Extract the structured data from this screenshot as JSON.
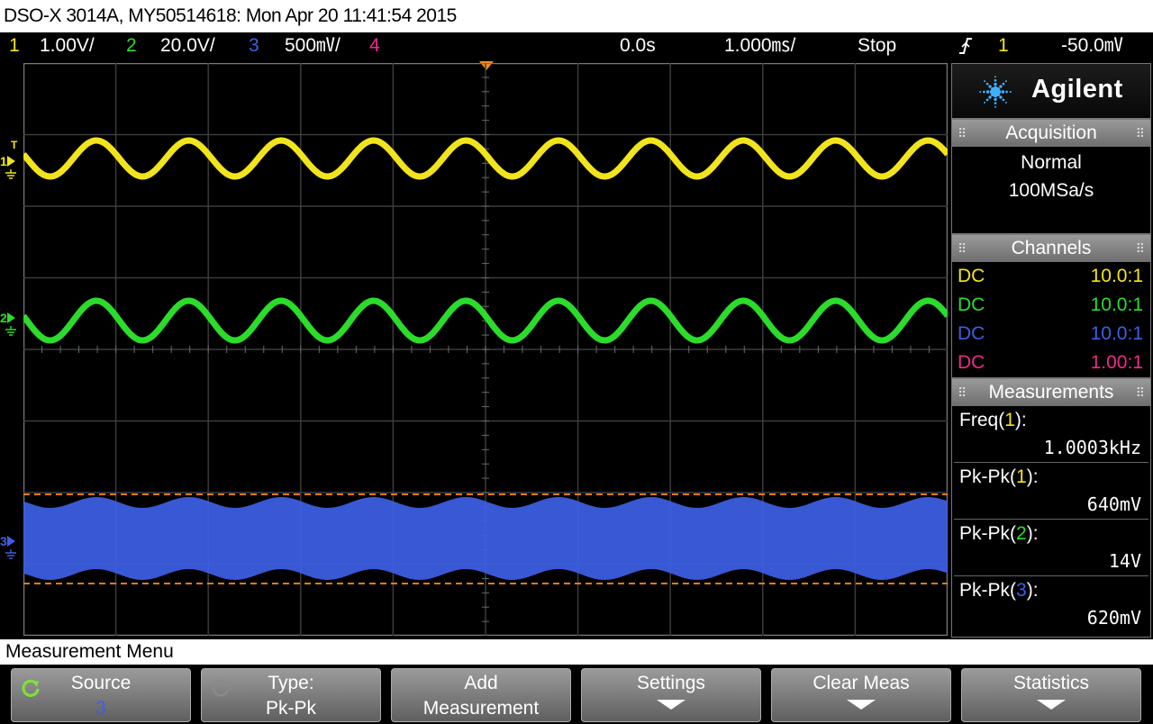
{
  "title": "DSO-X 3014A, MY50514618: Mon Apr 20 11:41:54 2015",
  "colors": {
    "ch1": "#f2e41c",
    "ch2": "#2bdc2b",
    "ch3": "#3d5fe6",
    "ch4": "#ee2a8a",
    "trigger": "#ff8c1a"
  },
  "status": {
    "ch1_num": "1",
    "ch1_scale": "1.00V/",
    "ch2_num": "2",
    "ch2_scale": "20.0V/",
    "ch3_num": "3",
    "ch3_scale": "500㎷/",
    "ch4_num": "4",
    "time_delay": "0.0s",
    "time_scale": "1.000㎳/",
    "run_state": "Stop",
    "trigger_slope_icon": "rising-edge-icon",
    "trigger_source": "1",
    "trigger_level": "-50.0㎷"
  },
  "channel_markers": {
    "ch1": "1",
    "ch2": "2",
    "ch3": "3",
    "trigger_level_marker": "T"
  },
  "panel": {
    "brand": "Agilent",
    "acquisition": {
      "header": "Acquisition",
      "mode": "Normal",
      "rate": "100MSa/s"
    },
    "channels": {
      "header": "Channels",
      "rows": [
        {
          "coupling": "DC",
          "ratio": "10.0:1"
        },
        {
          "coupling": "DC",
          "ratio": "10.0:1"
        },
        {
          "coupling": "DC",
          "ratio": "10.0:1"
        },
        {
          "coupling": "DC",
          "ratio": "1.00:1"
        }
      ]
    },
    "measurements": {
      "header": "Measurements",
      "items": [
        {
          "name": "Freq",
          "source": "1",
          "value": "1.0003kHz"
        },
        {
          "name": "Pk-Pk",
          "source": "1",
          "value": "640mV"
        },
        {
          "name": "Pk-Pk",
          "source": "2",
          "value": "14V"
        },
        {
          "name": "Pk-Pk",
          "source": "3",
          "value": "620mV"
        }
      ]
    }
  },
  "menu_title": "Measurement Menu",
  "softkeys": {
    "source": {
      "label": "Source",
      "value": "3"
    },
    "type": {
      "label": "Type:",
      "value": "Pk-Pk"
    },
    "add": {
      "label": "Add",
      "value": "Measurement"
    },
    "settings": {
      "label": "Settings"
    },
    "clear": {
      "label": "Clear Meas"
    },
    "statistics": {
      "label": "Statistics"
    }
  }
}
